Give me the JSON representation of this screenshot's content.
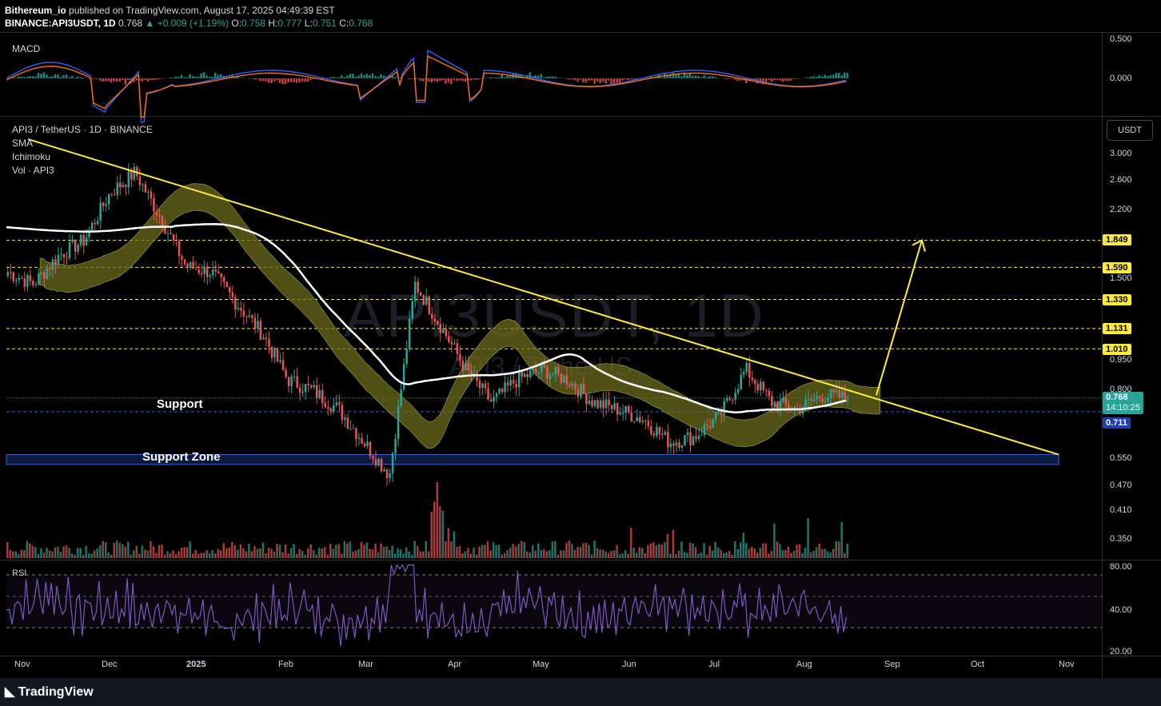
{
  "header": {
    "publisher": "Bithereum_io",
    "published_text": "published on TradingView.com, August 17, 2025 04:49:39 EST",
    "symbol": "BINANCE:API3USDT, 1D",
    "last": "0.768",
    "change": "+0.009 (+1.19%)",
    "o_label": "O:",
    "o": "0.758",
    "h_label": "H:",
    "h": "0.777",
    "l_label": "L:",
    "l": "0.751",
    "c_label": "C:",
    "c": "0.768"
  },
  "macd": {
    "title": "MACD",
    "axis": [
      "0.500",
      "0.000"
    ]
  },
  "main": {
    "legend_title": "API3 / TetherUS · 1D · BINANCE",
    "indicators": [
      "SMA",
      "Ichimoku",
      "Vol · API3"
    ],
    "currency_button": "USDT",
    "watermark_main": "API3USDT, 1D",
    "watermark_sub": "API3 / TetherUS",
    "axis": [
      "3.000",
      "2.600",
      "2.200",
      "1.500",
      "0.950",
      "0.800",
      "0.550",
      "0.470",
      "0.410",
      "0.350"
    ],
    "levels": [
      "1.849",
      "1.590",
      "1.330",
      "1.131",
      "1.010"
    ],
    "price_tag": "0.768",
    "countdown": "14:10:25",
    "support_tag": "0.711",
    "support_label": "Support",
    "support_zone_label": "Support Zone"
  },
  "rsi": {
    "title": "RSI",
    "axis": [
      "80.00",
      "40.00",
      "20.00"
    ]
  },
  "x_axis": [
    "Nov",
    "Dec",
    "2025",
    "Feb",
    "Mar",
    "Apr",
    "May",
    "Jun",
    "Jul",
    "Aug",
    "Sep",
    "Oct",
    "Nov"
  ],
  "footer": {
    "brand": "TradingView"
  },
  "colors": {
    "up": "#26a69a",
    "down": "#ef5350",
    "trend": "#ffeb3b",
    "sma": "#ffffff",
    "cloud": "#6b6a1e",
    "support_zone": "#1e3a8a",
    "rsi": "#7e57c2",
    "macd": "#2962ff",
    "signal": "#ff6d00"
  },
  "chart_data": {
    "type": "candlestick",
    "symbol": "API3USDT",
    "interval": "1D",
    "x": [
      "Nov",
      "Dec",
      "2025",
      "Feb",
      "Mar",
      "Apr",
      "May",
      "Jun",
      "Jul",
      "Aug",
      "Sep",
      "Oct",
      "Nov"
    ],
    "close_path": [
      1.55,
      1.45,
      1.7,
      1.85,
      2.4,
      2.7,
      2.1,
      1.6,
      1.55,
      1.3,
      1.1,
      0.85,
      0.8,
      0.72,
      0.6,
      0.5,
      1.45,
      1.15,
      0.9,
      0.75,
      0.85,
      0.9,
      0.85,
      0.75,
      0.72,
      0.68,
      0.6,
      0.62,
      0.7,
      0.9,
      0.75,
      0.72,
      0.78,
      0.768
    ],
    "last_close": 0.768,
    "resistance_levels": [
      1.849,
      1.59,
      1.33,
      1.131,
      1.01
    ],
    "support": 0.711,
    "support_zone": [
      0.53,
      0.56
    ],
    "target": 1.849
  }
}
